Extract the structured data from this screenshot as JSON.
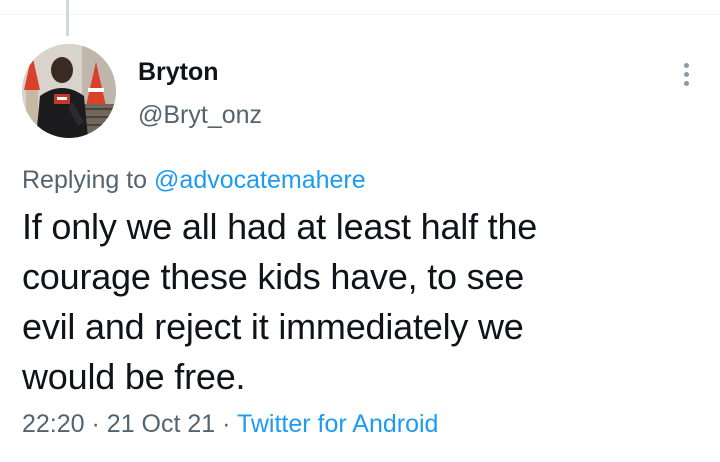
{
  "author": {
    "name": "Bryton",
    "handle": "@Bryt_onz"
  },
  "reply": {
    "prefix": "Replying to",
    "mention": "@advocatemahere"
  },
  "tweet": {
    "lines": [
      "If only we all had at least half the",
      "courage these kids have, to see",
      "evil and reject it immediately we",
      "would be free."
    ]
  },
  "meta": {
    "time": "22:20",
    "separator": "·",
    "date": "21 Oct 21",
    "source": "Twitter for Android"
  },
  "icons": {
    "more": "more-vertical-icon"
  },
  "colors": {
    "link": "#1d9bf0",
    "secondary_text": "#536471",
    "primary_text": "#0f1419"
  }
}
